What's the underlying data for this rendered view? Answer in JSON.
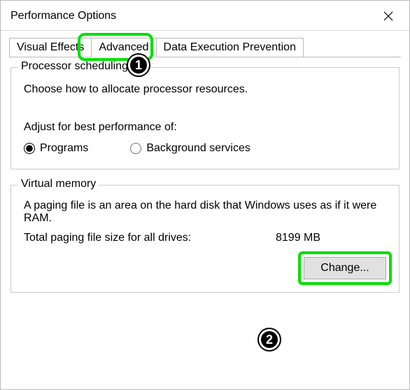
{
  "window": {
    "title": "Performance Options"
  },
  "tabs": {
    "visual_effects": "Visual Effects",
    "advanced": "Advanced",
    "dep": "Data Execution Prevention",
    "active": "advanced"
  },
  "callouts": {
    "one": "1",
    "two": "2"
  },
  "processor": {
    "title": "Processor scheduling",
    "description": "Choose how to allocate processor resources.",
    "adjust_label": "Adjust for best performance of:",
    "option_programs": "Programs",
    "option_background": "Background services",
    "selected": "programs"
  },
  "virtual_memory": {
    "title": "Virtual memory",
    "description": "A paging file is an area on the hard disk that Windows uses as if it were RAM.",
    "total_label": "Total paging file size for all drives:",
    "total_value": "8199 MB",
    "change_btn": "Change..."
  }
}
